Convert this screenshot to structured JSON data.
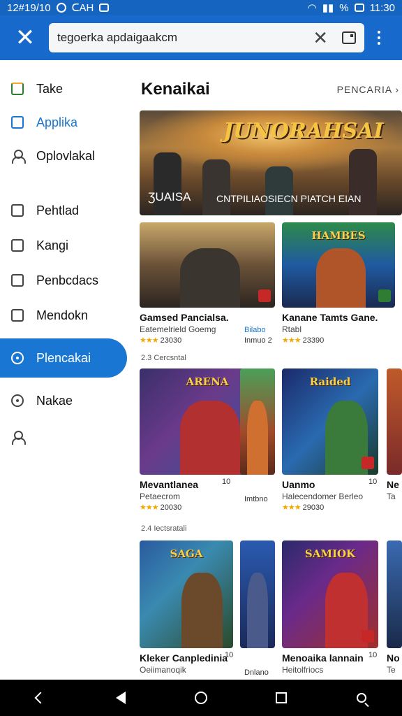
{
  "status_bar": {
    "left_text": "12#19/10",
    "carrier": "ᑕAH",
    "battery_pct": "%",
    "time": "11:30"
  },
  "search": {
    "value": "tegoerka apdaigaakcm",
    "placeholder": ""
  },
  "sidebar": {
    "items": [
      {
        "label": "Take",
        "icon": "store-icon"
      },
      {
        "label": "Applika",
        "icon": "apps-icon"
      },
      {
        "label": "Oplovlakal",
        "icon": "account-icon"
      },
      {
        "label": "Pehtlad",
        "icon": "library-icon"
      },
      {
        "label": "Kangi",
        "icon": "bag-icon"
      },
      {
        "label": "Penbcdacs",
        "icon": "image-icon"
      },
      {
        "label": "Mendokn",
        "icon": "book-icon"
      },
      {
        "label": "Plencakai",
        "icon": "clock-icon",
        "active": true
      },
      {
        "label": "Nakae",
        "icon": "settings-icon"
      },
      {
        "label": "",
        "icon": "person-icon"
      }
    ]
  },
  "main": {
    "section_title": "Kenaikai",
    "see_more": "PENCARIA ›",
    "banner": {
      "title": "JUNORAHSAI",
      "left": "ƷUAISA",
      "right": "CNTPILIAOSIECN PIATCH EIAN"
    },
    "row1": [
      {
        "title": "Gamsed Pancialsa.",
        "sub": "Eatemelrield Goemg",
        "stars": "★★★",
        "rating": "23030",
        "note": "Bilabo",
        "note2": "Inmuo 2"
      },
      {
        "title": "Kanane Tamts Gane.",
        "sub": "Rtabl",
        "stars": "★★★",
        "rating": "23390"
      }
    ],
    "row2_label": "2.3 Cercsntal",
    "row2": [
      {
        "title": "Mevantlanea",
        "sub": "Petaecrom",
        "stars": "★★★",
        "rating": "20030",
        "note": "10",
        "note2": "Imtbno"
      },
      {
        "title": "Uanmo",
        "sub": "Halecendomer Berleo",
        "stars": "★★★",
        "rating": "29030",
        "note": "10"
      },
      {
        "title": "Ne",
        "sub": "Ta"
      }
    ],
    "row3_label": "2.4 Iectsratali",
    "row3": [
      {
        "title": "Kleker Canpledinia",
        "sub": "Oeiimanoqik",
        "note": "10",
        "note2": "Dnlano"
      },
      {
        "title": "Menoaika lannain",
        "sub": "Heitolfriocs",
        "note": "10"
      },
      {
        "title": "No",
        "sub": "Te"
      }
    ]
  },
  "colors": {
    "accent": "#1976d2",
    "bar": "#1769cc",
    "star": "#f2a900"
  }
}
